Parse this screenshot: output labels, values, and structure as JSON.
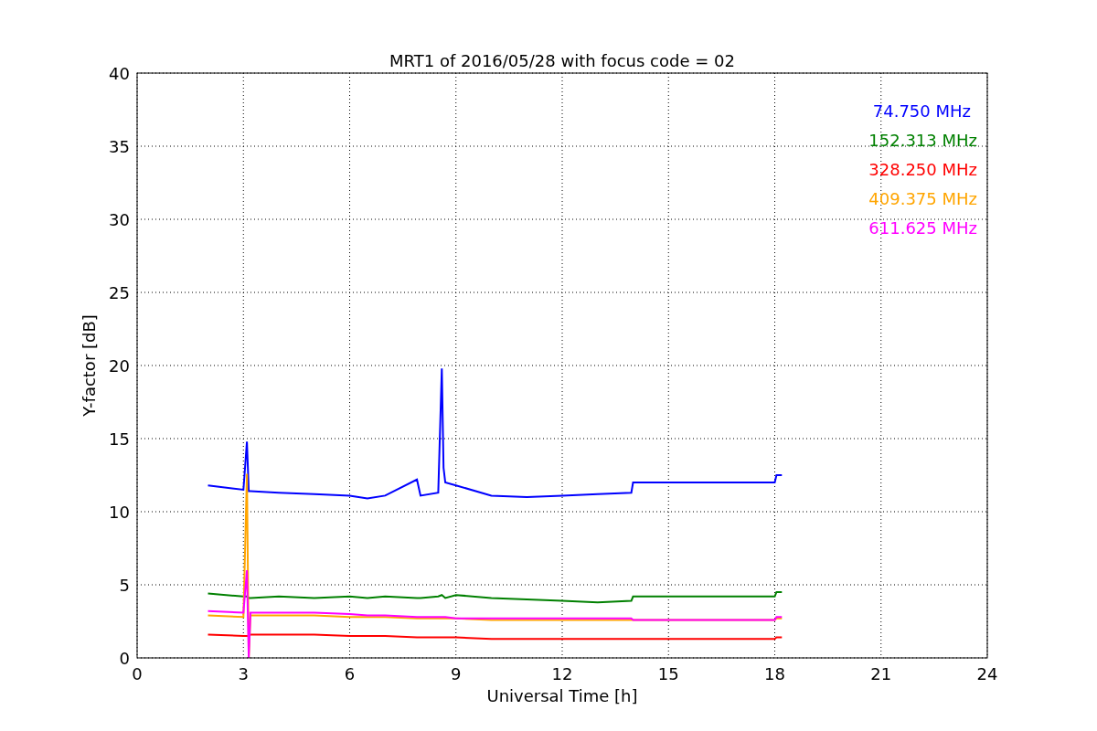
{
  "figure": {
    "chart_data": {
      "type": "line",
      "title": "MRT1 of 2016/05/28 with focus code = 02",
      "xlabel": "Universal Time [h]",
      "ylabel": "Y-factor [dB]",
      "x": [
        2,
        3,
        3.1,
        3.15,
        3.2,
        4,
        5,
        6,
        6.5,
        7,
        7.9,
        8,
        8.5,
        8.6,
        8.65,
        8.7,
        9,
        10,
        11,
        12,
        13,
        13.95,
        14,
        18,
        18.05,
        18.2
      ],
      "series": [
        {
          "name": "74.750 MHz",
          "color": "#0000ff",
          "values": [
            11.8,
            11.5,
            14.8,
            11.4,
            11.4,
            11.3,
            11.2,
            11.1,
            10.9,
            11.1,
            12.2,
            11.1,
            11.3,
            19.8,
            13,
            12,
            11.8,
            11.1,
            11.0,
            11.1,
            11.2,
            11.3,
            12.0,
            12.0,
            12.5,
            12.5
          ]
        },
        {
          "name": "152.313 MHz",
          "color": "#008000",
          "values": [
            4.4,
            4.2,
            4.2,
            4.1,
            4.1,
            4.2,
            4.1,
            4.2,
            4.1,
            4.2,
            4.1,
            4.1,
            4.2,
            4.3,
            4.2,
            4.1,
            4.3,
            4.1,
            4.0,
            3.9,
            3.8,
            3.9,
            4.2,
            4.2,
            4.5,
            4.5
          ]
        },
        {
          "name": "328.250 MHz",
          "color": "#ff0000",
          "values": [
            1.6,
            1.5,
            1.5,
            1.5,
            1.6,
            1.6,
            1.6,
            1.5,
            1.5,
            1.5,
            1.4,
            1.4,
            1.4,
            1.4,
            1.4,
            1.4,
            1.4,
            1.3,
            1.3,
            1.3,
            1.3,
            1.3,
            1.3,
            1.3,
            1.4,
            1.4
          ]
        },
        {
          "name": "409.375 MHz",
          "color": "#ffa500",
          "values": [
            2.9,
            2.8,
            12.6,
            0,
            2.9,
            2.9,
            2.9,
            2.8,
            2.8,
            2.8,
            2.7,
            2.7,
            2.7,
            2.7,
            2.7,
            2.7,
            2.7,
            2.6,
            2.6,
            2.6,
            2.6,
            2.6,
            2.6,
            2.6,
            2.7,
            2.7
          ]
        },
        {
          "name": "611.625 MHz",
          "color": "#ff00ff",
          "values": [
            3.2,
            3.1,
            6.0,
            0,
            3.1,
            3.1,
            3.1,
            3.0,
            2.9,
            2.9,
            2.8,
            2.8,
            2.8,
            2.8,
            2.8,
            2.8,
            2.7,
            2.7,
            2.7,
            2.7,
            2.7,
            2.7,
            2.6,
            2.6,
            2.8,
            2.8
          ]
        }
      ],
      "xlim": [
        0,
        24
      ],
      "ylim": [
        0,
        40
      ],
      "xticks": [
        0,
        3,
        6,
        9,
        12,
        15,
        18,
        21,
        24
      ],
      "yticks": [
        0,
        5,
        10,
        15,
        20,
        25,
        30,
        35,
        40
      ],
      "grid": true
    }
  }
}
